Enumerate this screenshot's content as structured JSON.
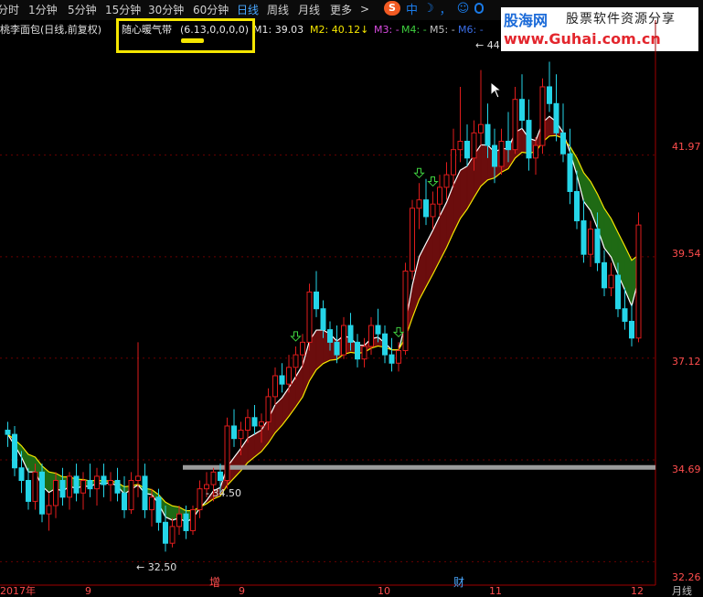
{
  "toolbar": {
    "periods": [
      "分时",
      "1分钟",
      "5分钟",
      "15分钟",
      "30分钟",
      "60分钟",
      "日线",
      "周线",
      "月线",
      "更多"
    ],
    "active_index": 6,
    "more_chevron": ">"
  },
  "ime": {
    "s_logo": "S",
    "zh": "中",
    "moon": "☽",
    "comma": "，",
    "emoji": "☺",
    "mic": "🎤"
  },
  "logo": {
    "name": "股海网",
    "tagline": "股票软件资源分享",
    "url": "www.Guhai.com.cn"
  },
  "chart_header": {
    "stock_name": "桃李面包(日线,前复权)",
    "indicator_name": "随心暖气带",
    "indicator_params": "(6.13,0,0,0,0)",
    "m1": "M1: 39.03",
    "m2": "M2: 40.12↓",
    "m3": "M3: -",
    "m4": "M4: -",
    "m5": "M5: -",
    "m6": "M6: -"
  },
  "accent": {
    "up": "#e01c1c",
    "down": "#25d5e8",
    "band_up": "#6b0d0d",
    "band_down": "#1f6a14",
    "highlight": "#f5e600"
  },
  "chart_data": {
    "type": "candlestick",
    "title": "桃李面包(日线,前复权)",
    "price_axis_ticks": [
      41.97,
      39.54,
      37.12,
      34.69,
      32.26
    ],
    "ylim": [
      31.7,
      44.8
    ],
    "x_axis_labels": [
      "2017年",
      "9",
      "9",
      "10",
      "11",
      "12"
    ],
    "right_axis_label": "月线",
    "annotations": {
      "high": "44",
      "low": "32.50",
      "support": "34.50"
    },
    "markers": [
      "增",
      "财"
    ],
    "candles": [
      [
        35.4,
        35.6,
        35.0,
        35.3
      ],
      [
        35.3,
        35.5,
        34.3,
        34.5
      ],
      [
        34.5,
        34.9,
        33.9,
        34.2
      ],
      [
        34.2,
        34.5,
        33.5,
        33.7
      ],
      [
        33.7,
        34.6,
        33.5,
        34.4
      ],
      [
        34.4,
        34.6,
        33.2,
        33.4
      ],
      [
        33.4,
        33.9,
        33.0,
        33.6
      ],
      [
        33.6,
        34.4,
        33.3,
        34.2
      ],
      [
        34.2,
        34.5,
        33.6,
        33.8
      ],
      [
        33.8,
        34.4,
        33.5,
        34.3
      ],
      [
        34.3,
        34.6,
        33.7,
        33.9
      ],
      [
        33.9,
        34.4,
        33.5,
        34.2
      ],
      [
        34.2,
        34.6,
        33.8,
        34.0
      ],
      [
        34.0,
        34.5,
        33.6,
        34.3
      ],
      [
        34.3,
        34.6,
        33.8,
        34.1
      ],
      [
        34.1,
        34.4,
        33.7,
        34.2
      ],
      [
        34.2,
        34.5,
        33.7,
        33.9
      ],
      [
        33.9,
        34.3,
        33.3,
        33.5
      ],
      [
        33.5,
        34.4,
        33.4,
        34.2
      ],
      [
        34.2,
        37.5,
        33.8,
        34.3
      ],
      [
        34.3,
        34.6,
        33.3,
        33.5
      ],
      [
        33.5,
        34.0,
        33.1,
        33.8
      ],
      [
        33.8,
        34.0,
        33.0,
        33.2
      ],
      [
        33.2,
        33.6,
        32.5,
        32.7
      ],
      [
        32.7,
        33.3,
        32.6,
        33.1
      ],
      [
        33.1,
        33.6,
        32.9,
        33.4
      ],
      [
        33.4,
        33.6,
        32.8,
        33.0
      ],
      [
        33.0,
        33.6,
        32.9,
        33.5
      ],
      [
        33.5,
        34.2,
        33.3,
        34.0
      ],
      [
        34.0,
        34.4,
        33.8,
        34.1
      ],
      [
        34.1,
        34.5,
        33.7,
        34.4
      ],
      [
        34.4,
        34.6,
        33.9,
        34.2
      ],
      [
        34.2,
        35.7,
        34.0,
        35.5
      ],
      [
        35.5,
        35.9,
        35.0,
        35.2
      ],
      [
        35.2,
        35.6,
        34.8,
        35.4
      ],
      [
        35.4,
        35.9,
        35.1,
        35.7
      ],
      [
        35.7,
        36.0,
        35.3,
        35.5
      ],
      [
        35.5,
        35.8,
        35.1,
        35.6
      ],
      [
        35.6,
        36.4,
        35.4,
        36.2
      ],
      [
        36.2,
        36.9,
        36.0,
        36.7
      ],
      [
        36.7,
        37.0,
        36.3,
        36.5
      ],
      [
        36.5,
        37.2,
        36.3,
        36.9
      ],
      [
        36.9,
        37.4,
        36.6,
        37.2
      ],
      [
        37.2,
        37.7,
        36.9,
        37.5
      ],
      [
        37.5,
        38.9,
        37.3,
        38.7
      ],
      [
        38.7,
        39.2,
        38.1,
        38.3
      ],
      [
        38.3,
        38.5,
        37.6,
        37.8
      ],
      [
        37.8,
        38.0,
        37.3,
        37.5
      ],
      [
        37.5,
        37.9,
        37.0,
        37.2
      ],
      [
        37.2,
        38.1,
        37.1,
        37.9
      ],
      [
        37.9,
        38.2,
        37.3,
        37.5
      ],
      [
        37.5,
        37.7,
        36.9,
        37.1
      ],
      [
        37.1,
        37.6,
        36.9,
        37.4
      ],
      [
        37.4,
        38.1,
        37.2,
        37.9
      ],
      [
        37.9,
        38.3,
        37.5,
        37.7
      ],
      [
        37.7,
        37.9,
        37.0,
        37.2
      ],
      [
        37.2,
        37.6,
        36.8,
        37.0
      ],
      [
        37.0,
        37.5,
        36.8,
        37.3
      ],
      [
        37.3,
        39.4,
        37.2,
        39.2
      ],
      [
        39.2,
        40.9,
        39.0,
        40.7
      ],
      [
        40.7,
        41.3,
        40.2,
        40.9
      ],
      [
        40.9,
        41.4,
        40.3,
        40.5
      ],
      [
        40.5,
        41.1,
        40.2,
        40.8
      ],
      [
        40.8,
        41.5,
        40.5,
        41.2
      ],
      [
        41.2,
        41.8,
        40.9,
        41.5
      ],
      [
        41.5,
        42.6,
        41.2,
        42.1
      ],
      [
        42.1,
        43.6,
        41.8,
        42.3
      ],
      [
        42.3,
        42.7,
        41.7,
        41.9
      ],
      [
        41.9,
        42.8,
        41.6,
        42.5
      ],
      [
        42.5,
        44.0,
        42.2,
        42.7
      ],
      [
        42.7,
        43.2,
        41.9,
        42.2
      ],
      [
        42.2,
        42.6,
        41.3,
        41.7
      ],
      [
        41.7,
        42.6,
        41.5,
        42.3
      ],
      [
        42.3,
        43.0,
        41.8,
        42.1
      ],
      [
        42.1,
        43.6,
        42.0,
        43.3
      ],
      [
        43.3,
        43.9,
        42.6,
        42.8
      ],
      [
        42.8,
        43.3,
        41.6,
        41.9
      ],
      [
        41.9,
        42.4,
        41.5,
        42.2
      ],
      [
        42.2,
        43.8,
        42.0,
        43.6
      ],
      [
        43.6,
        44.2,
        43.0,
        43.2
      ],
      [
        43.2,
        43.9,
        42.3,
        42.5
      ],
      [
        42.5,
        43.2,
        41.8,
        42.0
      ],
      [
        42.0,
        42.6,
        40.8,
        41.1
      ],
      [
        41.1,
        41.6,
        40.2,
        40.4
      ],
      [
        40.4,
        40.9,
        39.4,
        39.6
      ],
      [
        39.6,
        40.4,
        39.3,
        40.2
      ],
      [
        40.2,
        40.6,
        39.2,
        39.4
      ],
      [
        39.4,
        39.7,
        38.6,
        38.8
      ],
      [
        38.8,
        39.4,
        38.6,
        39.1
      ],
      [
        39.1,
        39.4,
        38.1,
        38.3
      ],
      [
        38.3,
        38.8,
        37.8,
        38.0
      ],
      [
        38.0,
        38.4,
        37.4,
        37.6
      ],
      [
        37.6,
        40.6,
        37.5,
        40.3
      ]
    ]
  }
}
